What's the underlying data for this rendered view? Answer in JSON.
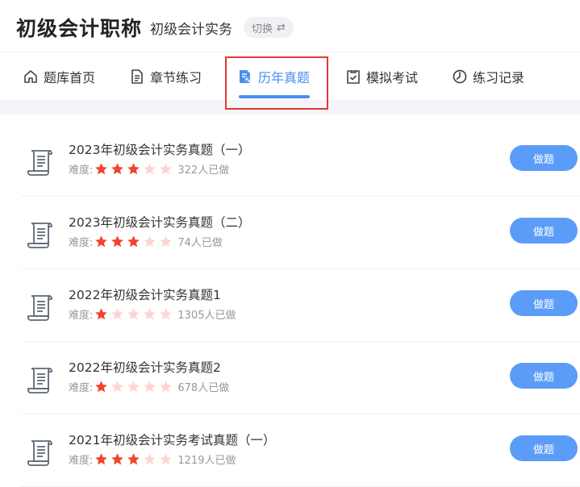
{
  "header": {
    "app_title": "初级会计职称",
    "subject": "初级会计实务",
    "switch_label": "切换",
    "switch_icon": "⇄"
  },
  "tabs": [
    {
      "label": "题库首页",
      "icon": "home-icon"
    },
    {
      "label": "章节练习",
      "icon": "document-icon"
    },
    {
      "label": "历年真题",
      "icon": "document-search-icon",
      "active": true
    },
    {
      "label": "模拟考试",
      "icon": "clipboard-check-icon"
    },
    {
      "label": "练习记录",
      "icon": "clock-icon"
    }
  ],
  "colors": {
    "accent": "#4a8ef0",
    "button": "#5b9cf8",
    "star_filled": "#f2452d",
    "star_empty": "#fbd7d1",
    "highlight": "#e53935"
  },
  "difficulty_label": "难度:",
  "action_label": "做题",
  "max_stars": 5,
  "papers": [
    {
      "title": "2023年初级会计实务真题（一）",
      "stars": 3,
      "count": "322人已做"
    },
    {
      "title": "2023年初级会计实务真题（二）",
      "stars": 3,
      "count": "74人已做"
    },
    {
      "title": "2022年初级会计实务真题1",
      "stars": 1,
      "count": "1305人已做"
    },
    {
      "title": "2022年初级会计实务真题2",
      "stars": 1,
      "count": "678人已做"
    },
    {
      "title": "2021年初级会计实务考试真题（一）",
      "stars": 3,
      "count": "1219人已做"
    }
  ]
}
